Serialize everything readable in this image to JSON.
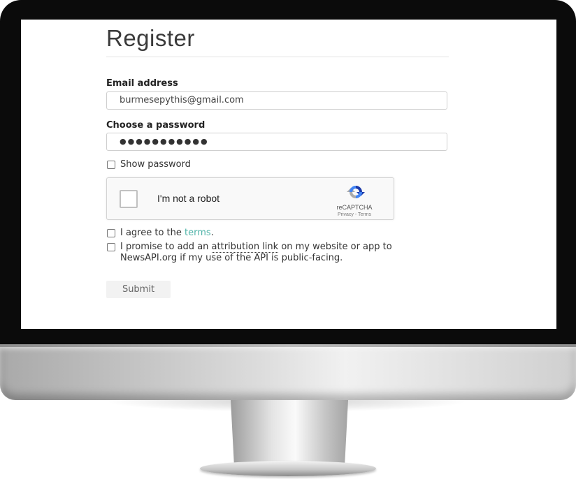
{
  "form": {
    "title": "Register",
    "email": {
      "label": "Email address",
      "value": "burmesepythis@gmail.com"
    },
    "password": {
      "label": "Choose a password",
      "value": "●●●●●●●●●●●"
    },
    "show_password": {
      "label": "Show password",
      "checked": false
    },
    "recaptcha": {
      "label": "I'm not a robot",
      "brand": "reCAPTCHA",
      "privacy": "Privacy",
      "separator": " - ",
      "terms": "Terms",
      "icon": "recaptcha-icon"
    },
    "agree": {
      "prefix": "I agree to the ",
      "link": "terms",
      "suffix": ".",
      "checked": false
    },
    "attribution": {
      "prefix": "I promise to add an ",
      "link": "attribution link",
      "suffix": " on my website or app to NewsAPI.org if my use of the API is public-facing.",
      "checked": false
    },
    "submit_label": "Submit"
  },
  "colors": {
    "link": "#4fb3a8",
    "bezel": "#0b0b0b",
    "submit_bg": "#f2f2f2"
  }
}
